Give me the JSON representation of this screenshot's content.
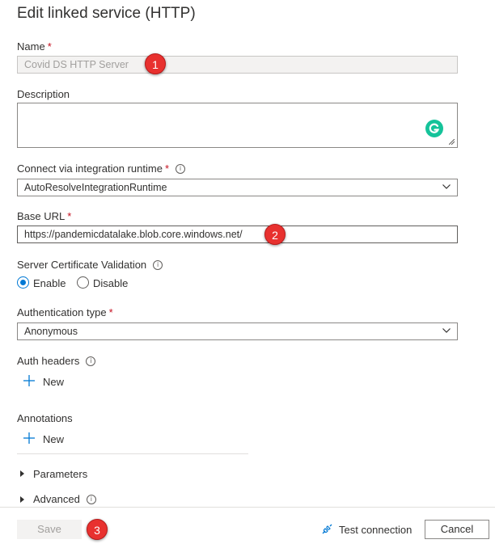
{
  "title": "Edit linked service (HTTP)",
  "name": {
    "label": "Name",
    "required": "*",
    "value": "Covid DS HTTP Server"
  },
  "description": {
    "label": "Description",
    "value": ""
  },
  "runtime": {
    "label": "Connect via integration runtime",
    "required": "*",
    "info": "i",
    "value": "AutoResolveIntegrationRuntime"
  },
  "base_url": {
    "label": "Base URL",
    "required": "*",
    "value": "https://pandemicdatalake.blob.core.windows.net/"
  },
  "cert_validation": {
    "label": "Server Certificate Validation",
    "info": "i",
    "options": [
      "Enable",
      "Disable"
    ],
    "selected": "Enable"
  },
  "auth_type": {
    "label": "Authentication type",
    "required": "*",
    "value": "Anonymous"
  },
  "auth_headers": {
    "label": "Auth headers",
    "info": "i",
    "new_label": "New"
  },
  "annotations": {
    "label": "Annotations",
    "new_label": "New"
  },
  "sections": {
    "parameters": "Parameters",
    "advanced": "Advanced",
    "advanced_info": "i"
  },
  "callouts": [
    "1",
    "2",
    "3"
  ],
  "footer": {
    "save": "Save",
    "test_connection": "Test connection",
    "cancel": "Cancel"
  },
  "colors": {
    "accent": "#0078d4",
    "callout": "#e8312f",
    "grammarly": "#15c39a"
  },
  "icons": [
    "info-icon",
    "chevron-down-icon",
    "plus-icon",
    "caret-right-icon",
    "plug-icon",
    "grammarly-icon"
  ]
}
